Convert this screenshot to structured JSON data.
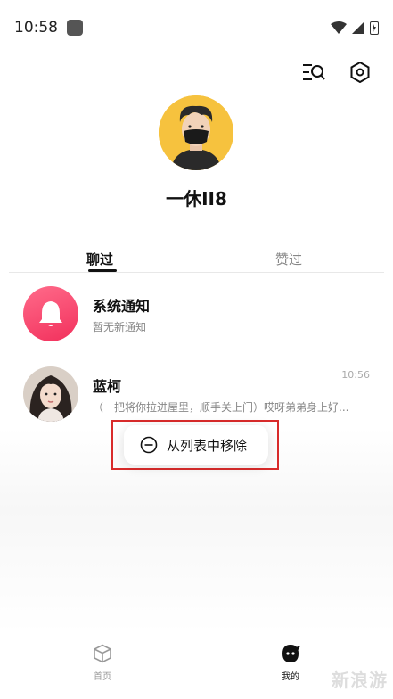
{
  "status_bar": {
    "time": "10:58"
  },
  "profile": {
    "username": "一休II8"
  },
  "tabs": [
    {
      "label": "聊过",
      "active": true
    },
    {
      "label": "赞过",
      "active": false
    }
  ],
  "conversations": [
    {
      "title": "系统通知",
      "subtitle": "暂无新通知",
      "time": ""
    },
    {
      "title": "蓝柯",
      "subtitle": "（一把将你拉进屋里，顺手关上门）哎呀弟弟身上好...",
      "time": "10:56"
    }
  ],
  "context_menu": {
    "remove_label": "从列表中移除"
  },
  "bottom_nav": [
    {
      "label": "首页",
      "icon": "cube-icon"
    },
    {
      "label": "我的",
      "icon": "profile-face-icon"
    }
  ],
  "watermark": "新浪游",
  "colors": {
    "accent_red": "#d92b2b",
    "bell_pink": "#f2305c",
    "avatar_yellow": "#f6c23e"
  }
}
